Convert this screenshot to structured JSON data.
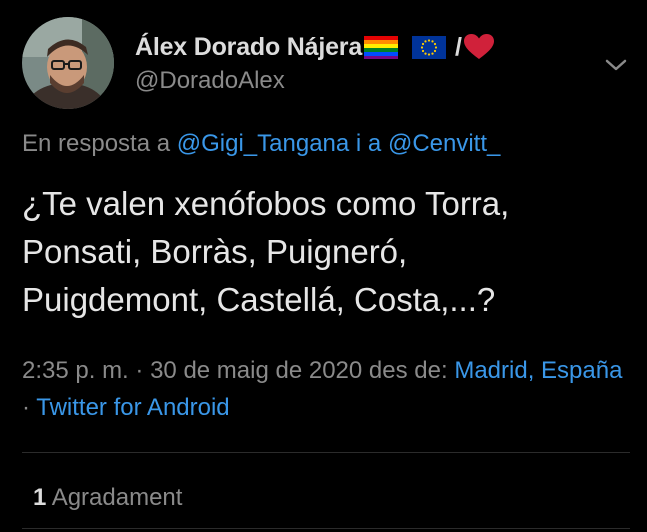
{
  "author": {
    "display_name": "Álex Dorado Nájera",
    "slash": "/",
    "handle": "@DoradoAlex",
    "avatar": "avatar-photo",
    "emoji": [
      "rainbow-flag-icon",
      "eu-flag-icon",
      "red-heart-icon"
    ]
  },
  "reply": {
    "prefix": "En resposta a",
    "user1": "@Gigi_Tangana",
    "connector": "i a",
    "user2": "@Cenvitt_"
  },
  "tweet": {
    "text": "¿Te valen xenófobos como Torra,\nPonsati, Borràs, Puigneró,\nPuigdemont, Castellá, Costa,...?"
  },
  "meta": {
    "time": "2:35 p. m.",
    "separator": "·",
    "date": "30 de maig de 2020",
    "from_label": "des de:",
    "location": "Madrid, España",
    "source": "Twitter for Android"
  },
  "likes": {
    "count": "1",
    "label": "Agradament"
  },
  "colors": {
    "background": "#000000",
    "text": "#e6e6e6",
    "secondary": "#8a8a8a",
    "link": "#3a97e8",
    "divider": "#2b2b2b",
    "heart": "#d0213a"
  }
}
